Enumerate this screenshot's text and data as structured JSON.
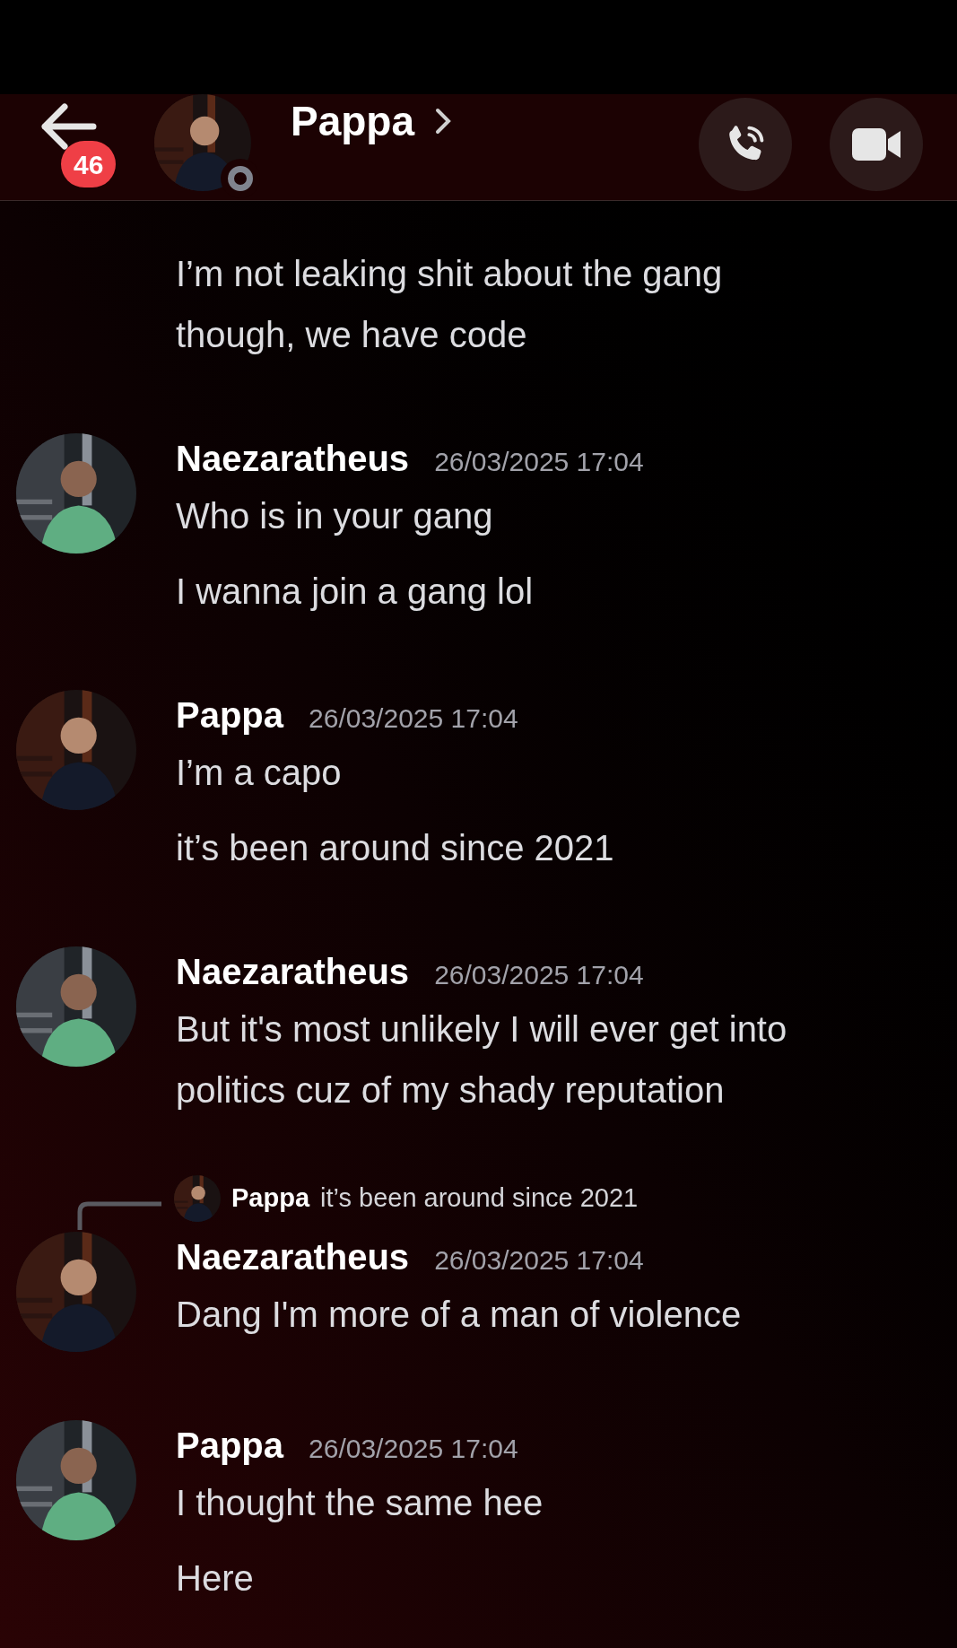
{
  "header": {
    "unread_badge": "46",
    "title": "Pappa",
    "online": false
  },
  "messages": [
    {
      "lines": [
        "I’m not leaking shit about the gang\nthough, we have code"
      ]
    },
    {
      "author": "Naezaratheus",
      "timestamp": "26/03/2025 17:04",
      "lines": [
        "Who is in your gang",
        "I wanna join a gang lol"
      ]
    },
    {
      "author": "Pappa",
      "timestamp": "26/03/2025 17:04",
      "lines": [
        "I’m a capo",
        "it’s been around since 2021"
      ]
    },
    {
      "author": "Naezaratheus",
      "timestamp": "26/03/2025 17:04",
      "lines": [
        "But it's most unlikely I will ever get into\npolitics cuz of my shady reputation"
      ]
    },
    {
      "author": "Naezaratheus",
      "timestamp": "26/03/2025 17:04",
      "reply": {
        "author": "Pappa",
        "text": "it’s been around since 2021"
      },
      "lines": [
        "Dang I'm more of a man of violence"
      ]
    },
    {
      "author": "Pappa",
      "timestamp": "26/03/2025 17:04",
      "lines": [
        "I thought the same hee",
        "Here"
      ]
    }
  ]
}
